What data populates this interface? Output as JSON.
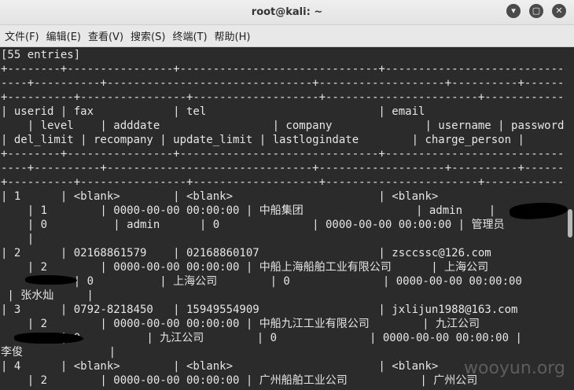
{
  "window": {
    "title": "root@kali: ~",
    "min_glyph": "▾",
    "max_glyph": "▢",
    "close_glyph": "✕"
  },
  "menu": [
    "文件(F)",
    "编辑(E)",
    "查看(V)",
    "搜索(S)",
    "终端(T)",
    "帮助(H)"
  ],
  "terminal": {
    "lines": [
      "[55 entries]",
      "+--------+----------------+------------------------------+-------------------------------",
      "----+----------+-------------------------------+-------------------+----------+------------",
      "+----------+----------------+-------------------+-----------------------+----------------+",
      "| userid | fax            | tel                          | email",
      "    | level    | adddate                 | company              | username | password",
      "| del_limit | recompany | update_limit | lastlogindate        | charge_person |",
      "+--------+----------------+------------------------------+-------------------------------",
      "----+----------+-------------------------------+-------------------+----------+------------",
      "+----------+----------------+-------------------+-----------------------+----------------+",
      "| 1      | <blank>        | <blank>                      | <blank>",
      "    | 1        | 0000-00-00 00:00:00 | 中船集团                 | admin    |",
      "    | 0          | admin      | 0              | 0000-00-00 00:00:00 | 管理员",
      "    |",
      "| 2      | 02168861579    | 02168860107                  | zsccssc@126.com",
      "    | 2        | 0000-00-00 00:00:00 | 中船上海船舶工业有限公司      | 上海公司",
      "           | 0          | 上海公司        | 0              | 0000-00-00 00:00:00",
      " | 张水灿     |",
      "| 3      | 0792-8218450   | 15949554909                  | jxlijun1988@163.com",
      "    | 2        | 0000-00-00 00:00:00 | 中船九江工业有限公司        | 九江公司",
      "         | 0          | 九江公司        | 0              | 0000-00-00 00:00:00 |",
      "李俊             |",
      "| 4      | <blank>        | <blank>                      | <blank>",
      "    | 2        | 0000-00-00 00:00:00 | 广州船舶工业公司           | 广州公司"
    ]
  },
  "watermark": "wooyun.org"
}
